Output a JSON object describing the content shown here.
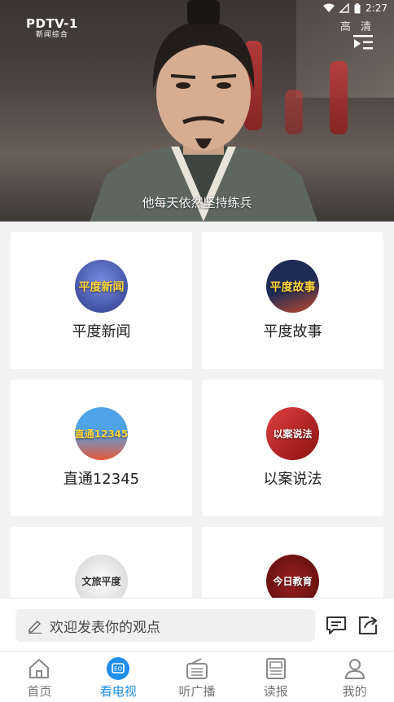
{
  "status_bar": {
    "time": "2:27"
  },
  "player": {
    "channel_logo_main": "PDTV-1",
    "channel_logo_sub": "新闻综合",
    "quality_label": "高 清",
    "subtitle": "他每天依然坚持练兵"
  },
  "programs": [
    {
      "label": "平度新闻",
      "thumb_text": "平度新闻",
      "thumb_colors": [
        "#6f7fd6",
        "#2c3a8a"
      ]
    },
    {
      "label": "平度故事",
      "thumb_text": "平度故事",
      "thumb_colors": [
        "#1d2b55",
        "#c64b2b"
      ]
    },
    {
      "label": "直通12345",
      "thumb_text": "直通12345",
      "thumb_colors": [
        "#4fa3e8",
        "#e85a3a"
      ]
    },
    {
      "label": "以案说法",
      "thumb_text": "以案说法",
      "thumb_colors": [
        "#d42a2a",
        "#8a1010"
      ]
    },
    {
      "label": "",
      "thumb_text": "文旅平度",
      "thumb_colors": [
        "#f5f5f5",
        "#cfcfcf"
      ]
    },
    {
      "label": "",
      "thumb_text": "今日教育",
      "thumb_colors": [
        "#8a1818",
        "#5a0c0c"
      ]
    }
  ],
  "comment_bar": {
    "placeholder": "欢迎发表你的观点"
  },
  "tabs": [
    {
      "label": "首页",
      "icon": "home-icon",
      "active": false
    },
    {
      "label": "看电视",
      "icon": "tv-icon",
      "active": true
    },
    {
      "label": "听广播",
      "icon": "radio-icon",
      "active": false
    },
    {
      "label": "读报",
      "icon": "newspaper-icon",
      "active": false
    },
    {
      "label": "我的",
      "icon": "user-icon",
      "active": false
    }
  ],
  "colors": {
    "accent": "#1e8ee8",
    "background": "#f2f2f2"
  }
}
